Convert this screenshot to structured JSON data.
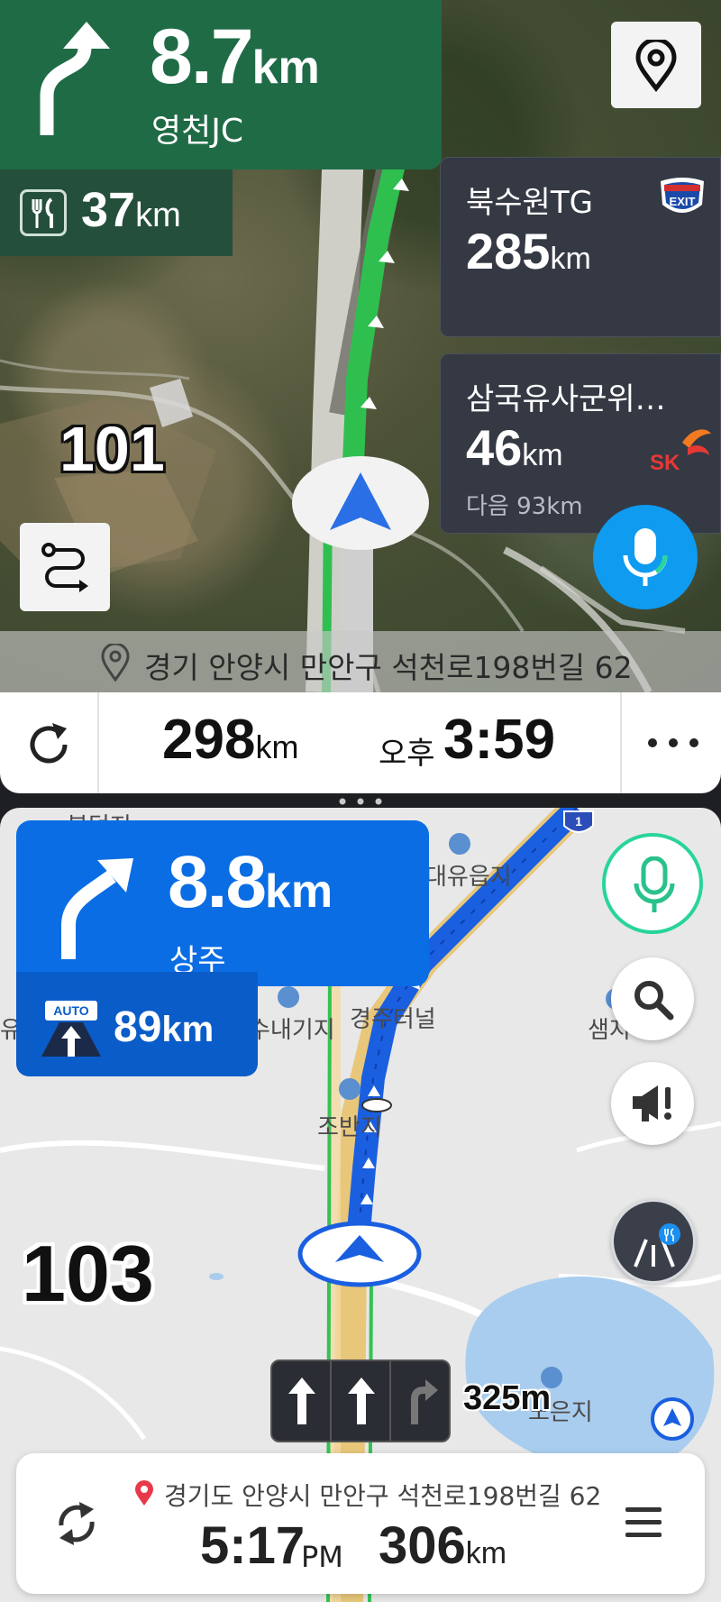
{
  "top_nav": {
    "distance_value": "8.7",
    "distance_unit": "km",
    "destination": "영천JC",
    "rest_area_value": "37",
    "rest_area_unit": "km",
    "road_number": "101",
    "address": "경기 안양시 만안구 석천로198번길 62"
  },
  "info_cards": [
    {
      "name": "북수원TG",
      "distance_value": "285",
      "distance_unit": "km",
      "badge_icon": "exit-badge-icon"
    },
    {
      "name": "삼국유사군위…",
      "distance_value": "46",
      "distance_unit": "km",
      "next_label": "다음 93km",
      "brand_icon": "sk-logo-icon",
      "brand_text": "SK"
    }
  ],
  "trip_bar": {
    "remaining_value": "298",
    "remaining_unit": "km",
    "ampm": "오후",
    "eta": "3:59"
  },
  "bottom_nav": {
    "distance_value": "8.8",
    "distance_unit": "km",
    "destination": "상주",
    "hipass_badge": "AUTO",
    "hipass_value": "89",
    "hipass_unit": "km",
    "road_number": "103",
    "lane_distance": "325m",
    "map_labels": {
      "top_left": "봉덕지",
      "reservoir_1": "대유읍지",
      "reservoir_2": "수내기지",
      "terminal": "경주터널",
      "reservoir_3": "조반지",
      "reservoir_4": "샘지",
      "left_edge": "유지",
      "reservoir_5": "노은지",
      "route_shield": "1"
    }
  },
  "bottom_bar": {
    "address": "경기도 안양시 만안구 석천로198번길 62",
    "eta": "5:17",
    "ampm": "PM",
    "remaining_value": "306",
    "remaining_unit": "km"
  },
  "colors": {
    "green_card": "#1f6b46",
    "blue_card": "#0a6de4",
    "route_green": "#2fbf4f",
    "route_blue": "#1a5fe0",
    "mic_blue": "#0e9bf0",
    "mic_ring_green": "#29d49a"
  }
}
